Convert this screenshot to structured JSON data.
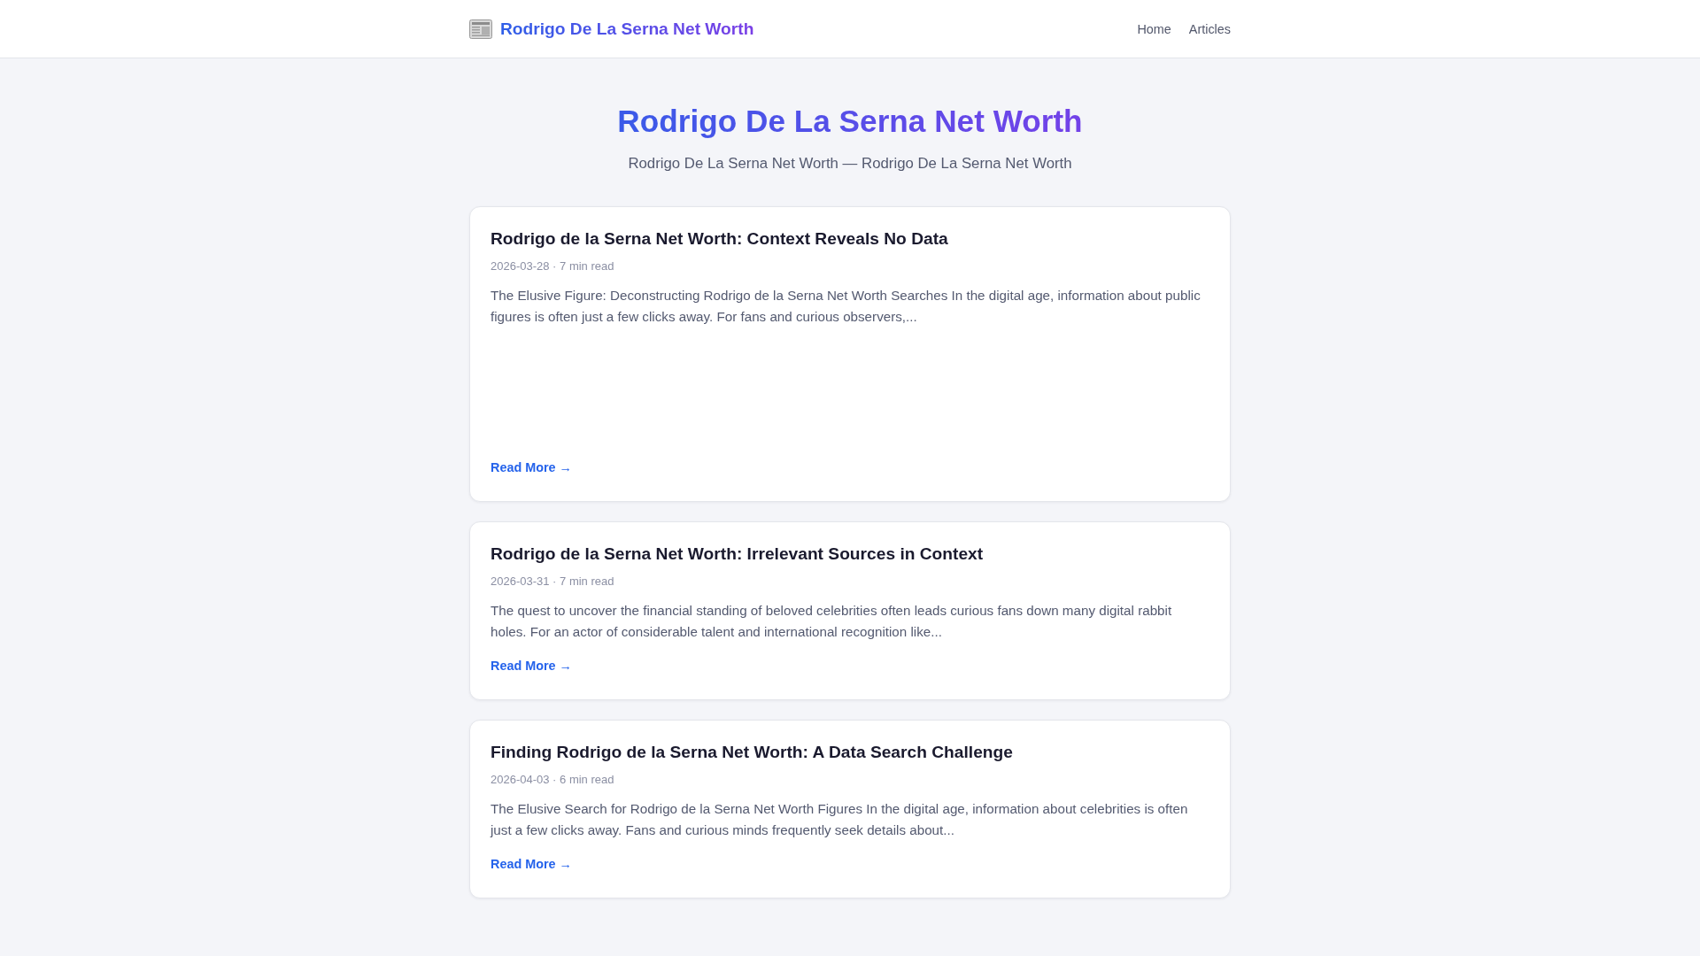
{
  "header": {
    "brand": "Rodrigo De La Serna Net Worth",
    "nav": [
      "Home",
      "Articles"
    ]
  },
  "hero": {
    "title": "Rodrigo De La Serna Net Worth",
    "subtitle": "Rodrigo De La Serna Net Worth — Rodrigo De La Serna Net Worth"
  },
  "articles": [
    {
      "kind": "padded",
      "title": "Rodrigo de la Serna Net Worth: Context Reveals No Data",
      "meta": "2026-03-28 · 7 min read",
      "excerpt": "The Elusive Figure: Deconstructing Rodrigo de la Serna Net Worth Searches In the digital age, information about public figures is often just a few clicks away. For fans and curious observers,...",
      "link": "Read More →"
    },
    {
      "kind": "standard",
      "title": "Rodrigo de la Serna Net Worth: Irrelevant Sources in Context",
      "meta": "2026-03-31 · 7 min read",
      "excerpt": "The quest to uncover the financial standing of beloved celebrities often leads curious fans down many digital rabbit holes. For an actor of considerable talent and international recognition like...",
      "link": "Read More →"
    },
    {
      "kind": "standard",
      "title": "Finding Rodrigo de la Serna Net Worth: A Data Search Challenge",
      "meta": "2026-04-03 · 6 min read",
      "excerpt": "The Elusive Search for Rodrigo de la Serna Net Worth Figures In the digital age, information about celebrities is often just a few clicks away. Fans and curious minds frequently seek details about...",
      "link": "Read More →"
    }
  ]
}
